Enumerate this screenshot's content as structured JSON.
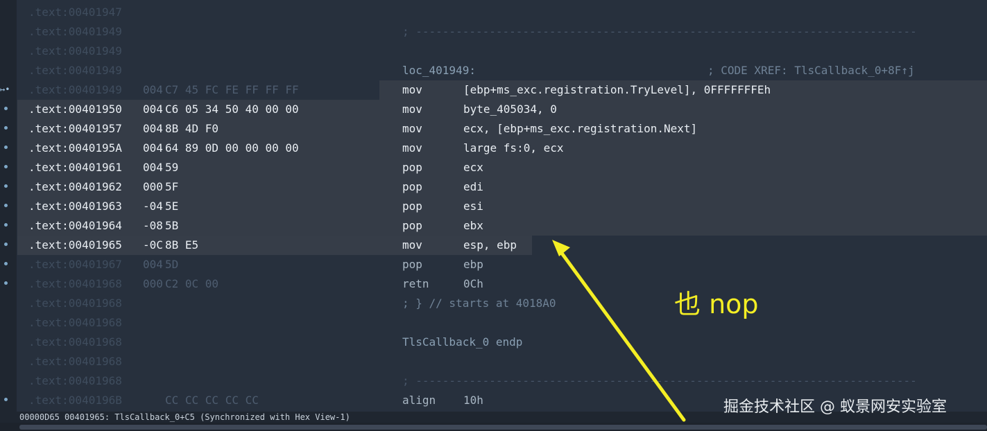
{
  "lines": [
    {
      "addr": ".text:00401947",
      "stack": "",
      "bytes": "",
      "mnem": "",
      "ops": "",
      "label": "",
      "comment": "",
      "sep": "",
      "style": "dim",
      "dot": false
    },
    {
      "addr": ".text:00401949",
      "stack": "",
      "bytes": "",
      "mnem": "",
      "ops": "",
      "label": "",
      "comment": "",
      "sep": "; ---------------------------------------------------------------------------",
      "style": "dim",
      "dot": false
    },
    {
      "addr": ".text:00401949",
      "stack": "",
      "bytes": "",
      "mnem": "",
      "ops": "",
      "label": "",
      "comment": "",
      "sep": "",
      "style": "dim",
      "dot": false
    },
    {
      "addr": ".text:00401949",
      "stack": "",
      "bytes": "",
      "mnem": "",
      "ops": "",
      "label": "loc_401949:",
      "comment": "; CODE XREF: TlsCallback_0+8F↑j",
      "sep": "",
      "style": "dim",
      "dot": false
    },
    {
      "addr": ".text:00401949",
      "stack": "004",
      "bytes": "C7 45 FC FE FF FF FF",
      "mnem": "mov",
      "ops": "[ebp+ms_exc.registration.TryLevel], 0FFFFFFFEh",
      "label": "",
      "comment": "",
      "sep": "",
      "style": "hl-right",
      "dot": false,
      "arrow": "↦•"
    },
    {
      "addr": ".text:00401950",
      "stack": "004",
      "bytes": "C6 05 34 50 40 00 00",
      "mnem": "mov",
      "ops": "byte_405034, 0",
      "label": "",
      "comment": "",
      "sep": "",
      "style": "hl-full",
      "dot": true
    },
    {
      "addr": ".text:00401957",
      "stack": "004",
      "bytes": "8B 4D F0",
      "mnem": "mov",
      "ops": "ecx, [ebp+ms_exc.registration.Next]",
      "label": "",
      "comment": "",
      "sep": "",
      "style": "hl-full",
      "dot": true
    },
    {
      "addr": ".text:0040195A",
      "stack": "004",
      "bytes": "64 89 0D 00 00 00 00",
      "mnem": "mov",
      "ops": "large fs:0, ecx",
      "label": "",
      "comment": "",
      "sep": "",
      "style": "hl-full",
      "dot": true
    },
    {
      "addr": ".text:00401961",
      "stack": "004",
      "bytes": "59",
      "mnem": "pop",
      "ops": "ecx",
      "label": "",
      "comment": "",
      "sep": "",
      "style": "hl-full",
      "dot": true
    },
    {
      "addr": ".text:00401962",
      "stack": "000",
      "bytes": "5F",
      "mnem": "pop",
      "ops": "edi",
      "label": "",
      "comment": "",
      "sep": "",
      "style": "hl-full",
      "dot": true
    },
    {
      "addr": ".text:00401963",
      "stack": "-04",
      "bytes": "5E",
      "mnem": "pop",
      "ops": "esi",
      "label": "",
      "comment": "",
      "sep": "",
      "style": "hl-full",
      "dot": true
    },
    {
      "addr": ".text:00401964",
      "stack": "-08",
      "bytes": "5B",
      "mnem": "pop",
      "ops": "ebx",
      "label": "",
      "comment": "",
      "sep": "",
      "style": "hl-full",
      "dot": true
    },
    {
      "addr": ".text:00401965",
      "stack": "-0C",
      "bytes": "8B E5",
      "mnem": "mov",
      "ops": "esp, ebp",
      "label": "",
      "comment": "",
      "sep": "",
      "style": "hl-short",
      "dot": true
    },
    {
      "addr": ".text:00401967",
      "stack": "004",
      "bytes": "5D",
      "mnem": "pop",
      "ops": "ebp",
      "label": "",
      "comment": "",
      "sep": "",
      "style": "normal",
      "dot": true
    },
    {
      "addr": ".text:00401968",
      "stack": "000",
      "bytes": "C2 0C 00",
      "mnem": "retn",
      "ops": "0Ch",
      "label": "",
      "comment": "",
      "sep": "",
      "style": "normal",
      "dot": true
    },
    {
      "addr": ".text:00401968",
      "stack": "",
      "bytes": "",
      "mnem": "",
      "ops": "",
      "label": "",
      "comment": "",
      "sep": "; } // starts at 4018A0",
      "style": "dim",
      "dot": false
    },
    {
      "addr": ".text:00401968",
      "stack": "",
      "bytes": "",
      "mnem": "",
      "ops": "",
      "label": "",
      "comment": "",
      "sep": "",
      "style": "dim",
      "dot": false
    },
    {
      "addr": ".text:00401968",
      "stack": "",
      "bytes": "",
      "mnem": "",
      "ops": "",
      "label": "TlsCallback_0 endp",
      "comment": "",
      "sep": "",
      "style": "dim",
      "dot": false
    },
    {
      "addr": ".text:00401968",
      "stack": "",
      "bytes": "",
      "mnem": "",
      "ops": "",
      "label": "",
      "comment": "",
      "sep": "",
      "style": "dim",
      "dot": false
    },
    {
      "addr": ".text:00401968",
      "stack": "",
      "bytes": "",
      "mnem": "",
      "ops": "",
      "label": "",
      "comment": "",
      "sep": "; ---------------------------------------------------------------------------",
      "style": "dim",
      "dot": false
    },
    {
      "addr": ".text:0040196B",
      "stack": "",
      "bytes": "CC CC CC CC CC",
      "mnem": "align",
      "ops": "10h",
      "label": "",
      "comment": "",
      "sep": "",
      "style": "normal",
      "dot": true
    }
  ],
  "status_bar": {
    "text": "00000D65 00401965: TlsCallback_0+C5 (Synchronized with Hex View-1)"
  },
  "annotation": {
    "text": "也 nop",
    "color": "#f4ee24"
  },
  "watermark": {
    "text": "掘金技术社区 @ 蚁景网安实验室"
  },
  "colors": {
    "highlight": "#353c47",
    "background": "#27303d",
    "gutter": "#1f2630"
  }
}
